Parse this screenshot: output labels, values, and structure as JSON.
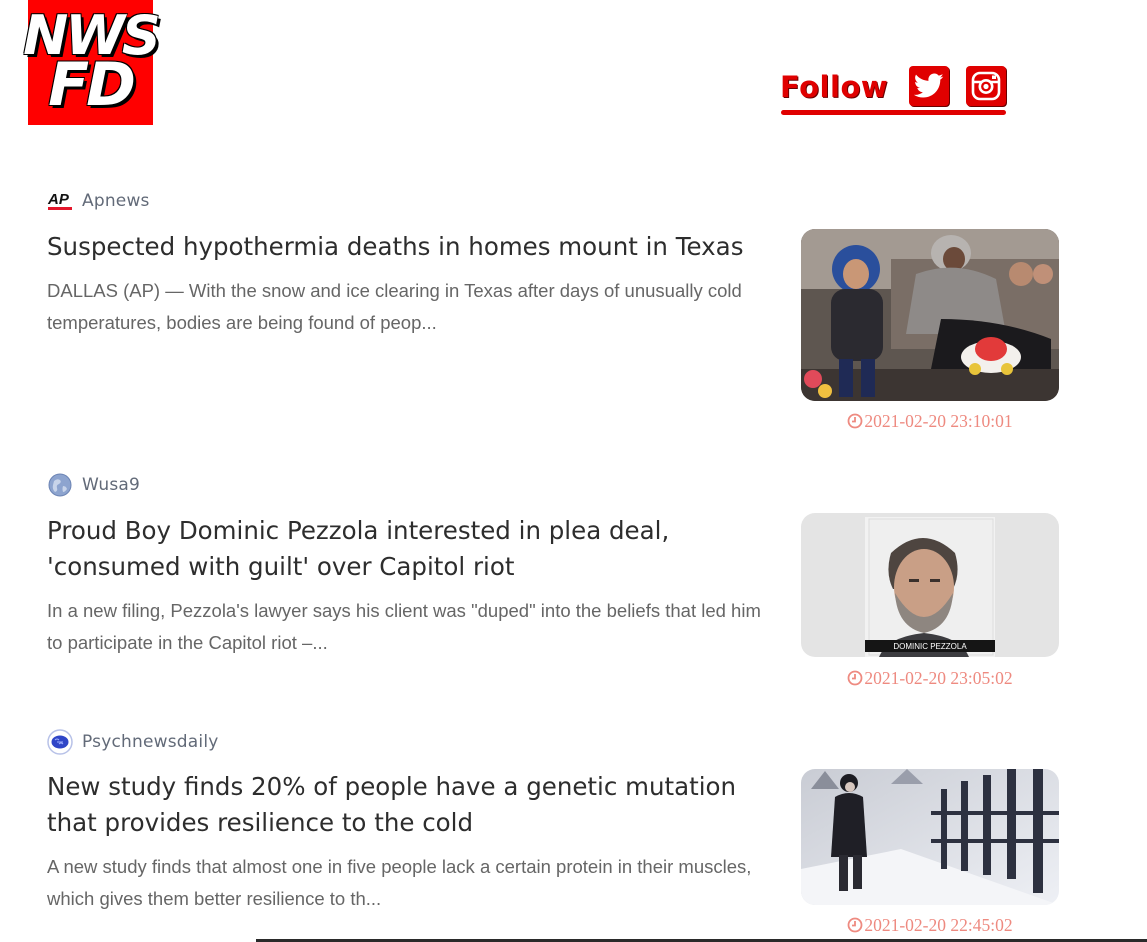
{
  "header": {
    "logo_line1": "NWS",
    "logo_line2": "FD",
    "follow_label": "Follow",
    "follow_icons": [
      "twitter-icon",
      "instagram-icon"
    ]
  },
  "articles": [
    {
      "source": "Apnews",
      "source_icon": "ap-logo-icon",
      "source_icon_text": "AP",
      "title": "Suspected hypothermia deaths in homes mount in Texas",
      "summary": "DALLAS (AP) — With the snow and ice clearing in Texas after days of unusually cold temperatures, bodies are being found of peop...",
      "timestamp": "2021-02-20 23:10:01"
    },
    {
      "source": "Wusa9",
      "source_icon": "globe-icon",
      "title": "Proud Boy Dominic Pezzola interested in plea deal, 'consumed with guilt' over Capitol riot",
      "summary": "In a new filing, Pezzola's lawyer says his client was \"duped\" into the beliefs that led him to participate in the Capitol riot –...",
      "image_caption": "DOMINIC PEZZOLA",
      "timestamp": "2021-02-20 23:05:02"
    },
    {
      "source": "Psychnewsdaily",
      "source_icon": "brain-icon",
      "title": "New study finds 20% of people have a genetic mutation that provides resilience to the cold",
      "summary": "A new study finds that almost one in five people lack a certain protein in their muscles, which gives them better resilience to th...",
      "timestamp": "2021-02-20 22:45:02"
    }
  ],
  "colors": {
    "brand_red": "#ff0000",
    "follow_red": "#e00000",
    "timestamp": "#ee8a80",
    "title": "#2d2d2d",
    "summary": "#666666",
    "source": "#626a78"
  }
}
